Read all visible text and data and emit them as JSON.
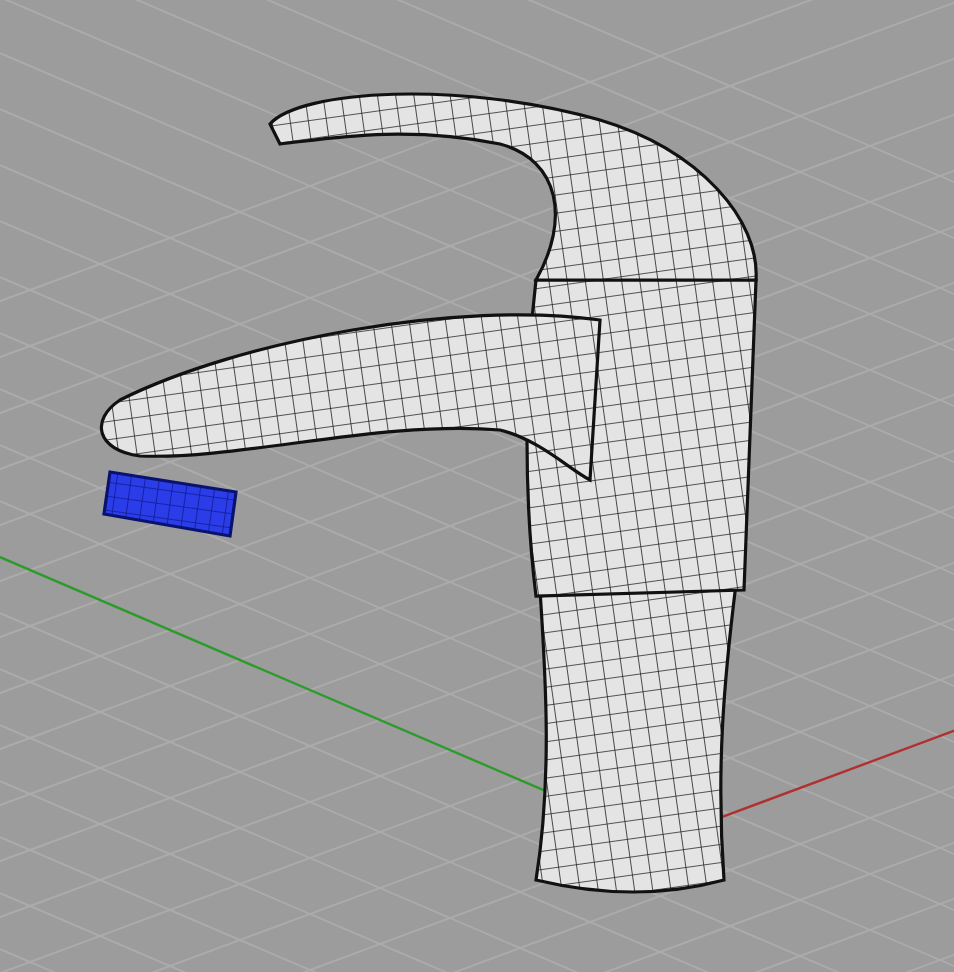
{
  "viewport": {
    "grid": true,
    "axes": true
  },
  "model": {
    "parts": [
      {
        "kind": "body",
        "selected": false
      },
      {
        "kind": "aerator",
        "selected": true
      }
    ]
  }
}
